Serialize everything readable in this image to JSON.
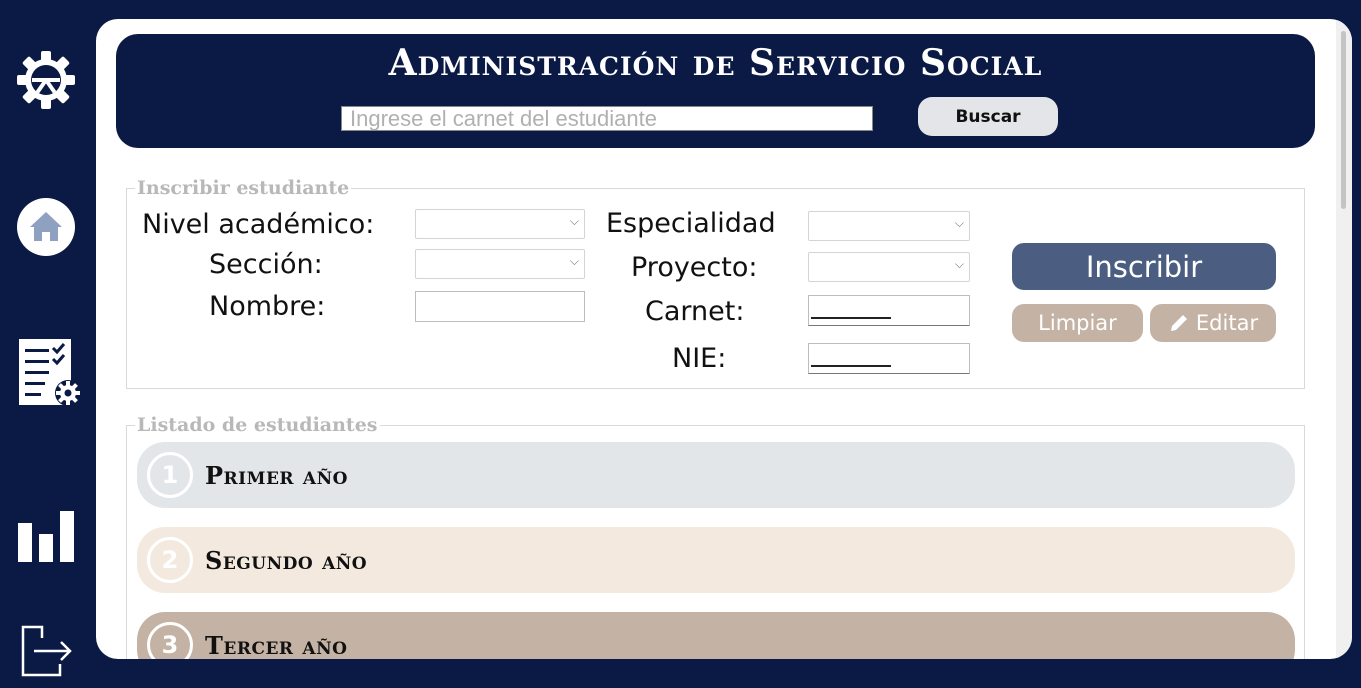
{
  "sidebar": {
    "items": [
      {
        "icon": "gear-icon"
      },
      {
        "icon": "home-icon"
      },
      {
        "icon": "checklist-settings-icon"
      },
      {
        "icon": "bar-chart-icon"
      },
      {
        "icon": "logout-icon"
      }
    ]
  },
  "header": {
    "title": "Administración de Servicio Social",
    "search_placeholder": "Ingrese el carnet del estudiante",
    "search_button": "Buscar"
  },
  "form": {
    "legend": "Inscribir estudiante",
    "nivel_label": "Nivel académico:",
    "seccion_label": "Sección:",
    "nombre_label": "Nombre:",
    "especialidad_label": "Especialidad",
    "proyecto_label": "Proyecto:",
    "carnet_label": "Carnet:",
    "nie_label": "NIE:",
    "inscribir_button": "Inscribir",
    "limpiar_button": "Limpiar",
    "editar_button": "Editar"
  },
  "list": {
    "legend": "Listado de estudiantes",
    "years": [
      {
        "number": "1",
        "label": "Primer año",
        "color": "#e3e6e9"
      },
      {
        "number": "2",
        "label": "Segundo año",
        "color": "#f4e9df"
      },
      {
        "number": "3",
        "label": "Tercer año",
        "color": "#c4b3a4"
      }
    ]
  },
  "colors": {
    "navy": "#0b1a44",
    "accent_blue": "#4b5e82",
    "accent_tan": "#c4b3a4"
  }
}
